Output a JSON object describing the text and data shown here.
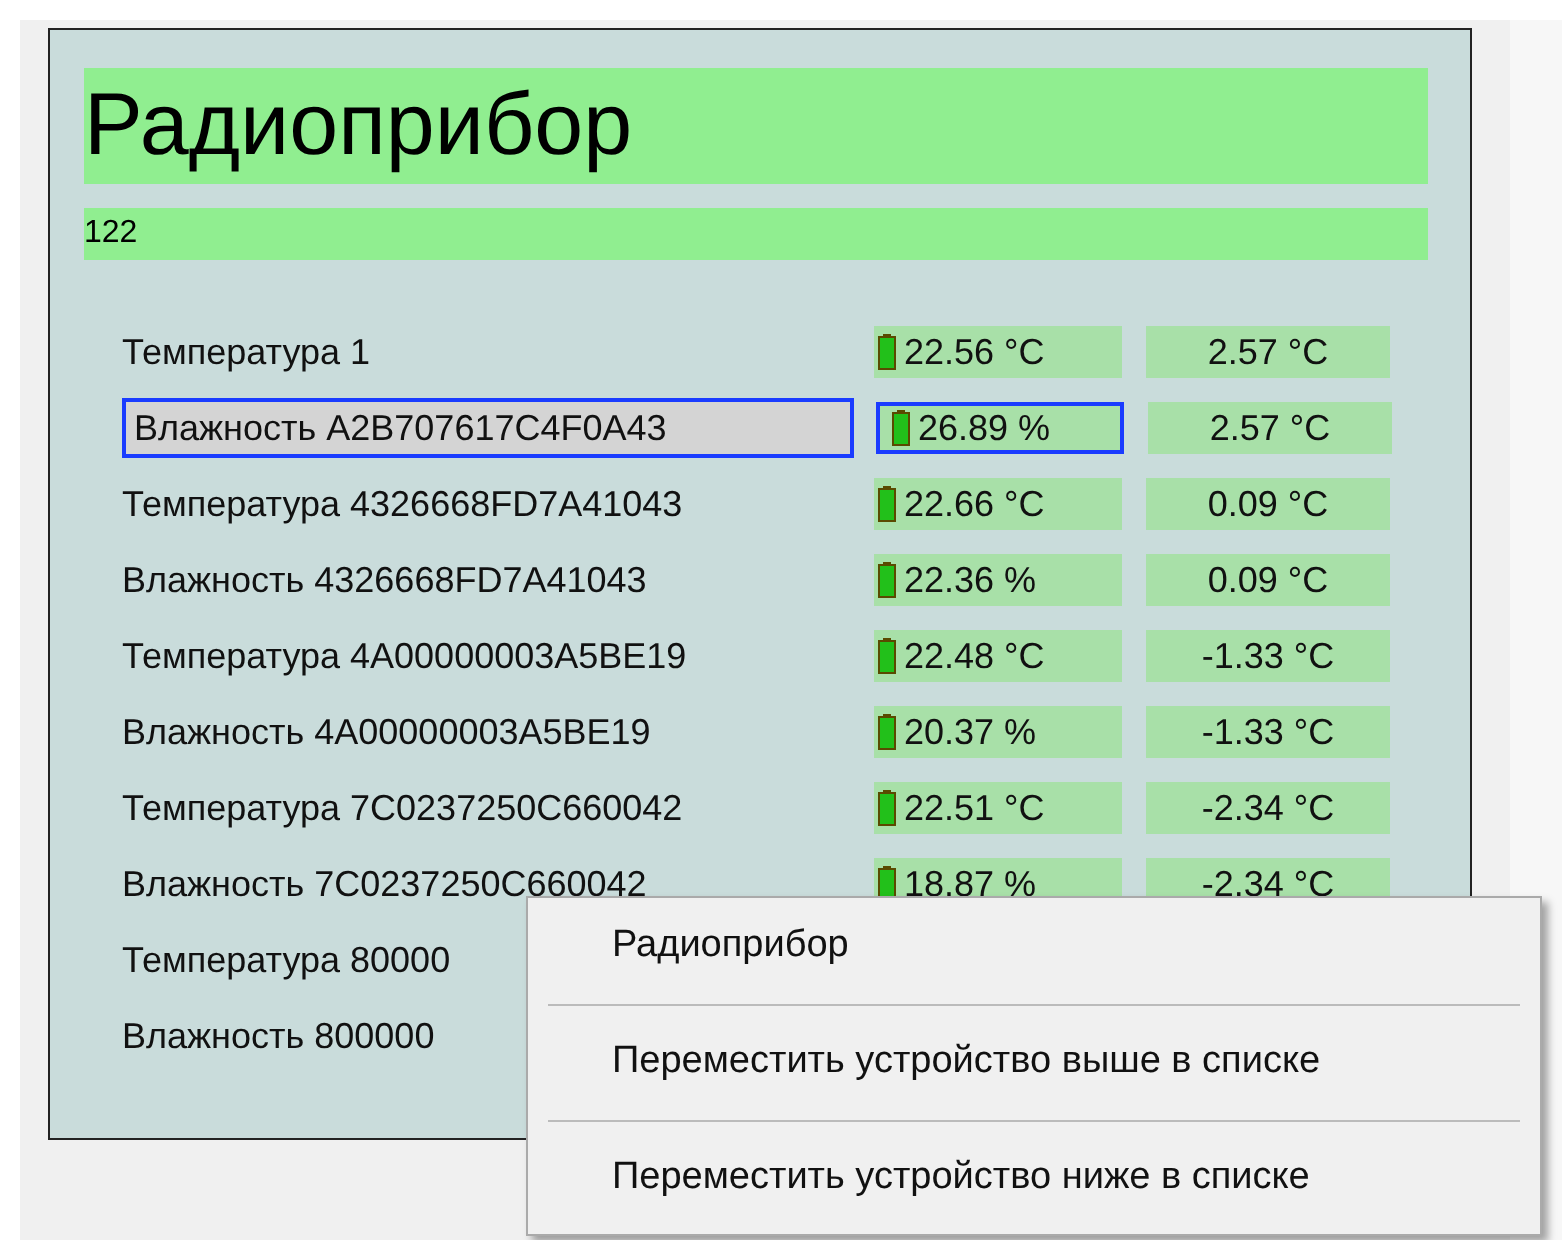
{
  "header": {
    "title": "Радиоприбор",
    "subtitle": "122"
  },
  "rows": [
    {
      "name": "Температура 1",
      "value": "22.56 °C",
      "delta": "2.57 °C",
      "selected": false
    },
    {
      "name": "Влажность A2B707617C4F0A43",
      "value": "26.89 %",
      "delta": "2.57 °C",
      "selected": true
    },
    {
      "name": "Температура 4326668FD7A41043",
      "value": "22.66 °C",
      "delta": "0.09 °C",
      "selected": false
    },
    {
      "name": "Влажность 4326668FD7A41043",
      "value": "22.36 %",
      "delta": "0.09 °C",
      "selected": false
    },
    {
      "name": "Температура 4A00000003A5BE19",
      "value": "22.48 °C",
      "delta": "-1.33 °C",
      "selected": false
    },
    {
      "name": "Влажность 4A00000003A5BE19",
      "value": "20.37 %",
      "delta": "-1.33 °C",
      "selected": false
    },
    {
      "name": "Температура 7C0237250C660042",
      "value": "22.51 °C",
      "delta": "-2.34 °C",
      "selected": false
    },
    {
      "name": "Влажность 7C0237250C660042",
      "value": "18.87 %",
      "delta": "-2.34 °C",
      "selected": false
    },
    {
      "name": "Температура 80000",
      "selected": false
    },
    {
      "name": "Влажность 800000",
      "selected": false
    }
  ],
  "context_menu": {
    "items": [
      "Радиоприбор",
      "Переместить устройство выше в списке",
      "Переместить устройство ниже в списке"
    ]
  }
}
